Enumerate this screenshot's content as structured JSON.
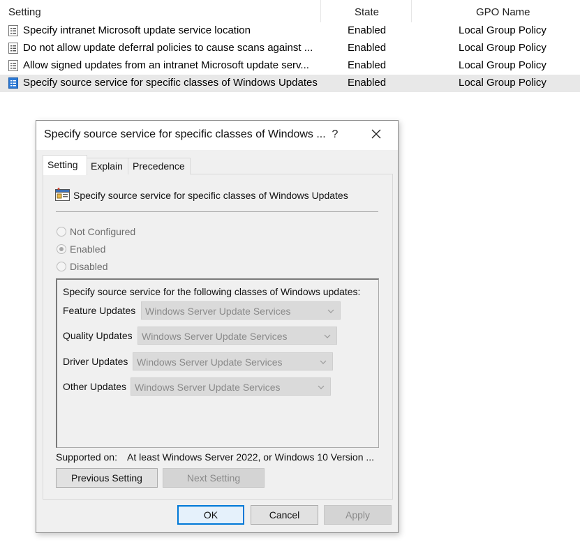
{
  "list": {
    "headers": {
      "setting": "Setting",
      "state": "State",
      "gpo": "GPO Name"
    },
    "rows": [
      {
        "name": "Specify intranet Microsoft update service location",
        "state": "Enabled",
        "gpo": "Local Group Policy",
        "selected": false
      },
      {
        "name": "Do not allow update deferral policies to cause scans against ...",
        "state": "Enabled",
        "gpo": "Local Group Policy",
        "selected": false
      },
      {
        "name": "Allow signed updates from an intranet Microsoft update serv...",
        "state": "Enabled",
        "gpo": "Local Group Policy",
        "selected": false
      },
      {
        "name": "Specify source service for specific classes of Windows Updates",
        "state": "Enabled",
        "gpo": "Local Group Policy",
        "selected": true
      }
    ]
  },
  "dialog": {
    "title": "Specify source service for specific classes of Windows ...",
    "help": "?",
    "tabs": [
      "Setting",
      "Explain",
      "Precedence"
    ],
    "active_tab": "Setting",
    "policy_title": "Specify source service for specific classes of Windows Updates",
    "radios": {
      "not_configured": "Not Configured",
      "enabled": "Enabled",
      "disabled": "Disabled",
      "selected": "Enabled"
    },
    "options": {
      "heading": "Specify source service for the following classes of Windows updates:",
      "items": [
        {
          "label": "Feature Updates",
          "value": "Windows Server Update Services"
        },
        {
          "label": "Quality Updates",
          "value": "Windows Server Update Services"
        },
        {
          "label": "Driver Updates",
          "value": "Windows Server Update Services"
        },
        {
          "label": "Other Updates",
          "value": "Windows Server Update Services"
        }
      ]
    },
    "supported_on_label": "Supported on:",
    "supported_on_value": "At least Windows Server 2022, or Windows 10 Version ...",
    "buttons": {
      "previous": "Previous Setting",
      "next": "Next Setting",
      "ok": "OK",
      "cancel": "Cancel",
      "apply": "Apply"
    }
  },
  "colors": {
    "selected_row": "#e8e8e8",
    "dialog_bg": "#f0f0f0",
    "default_button_border": "#0078d7",
    "policy_icon_blue": "#2b78d4"
  }
}
